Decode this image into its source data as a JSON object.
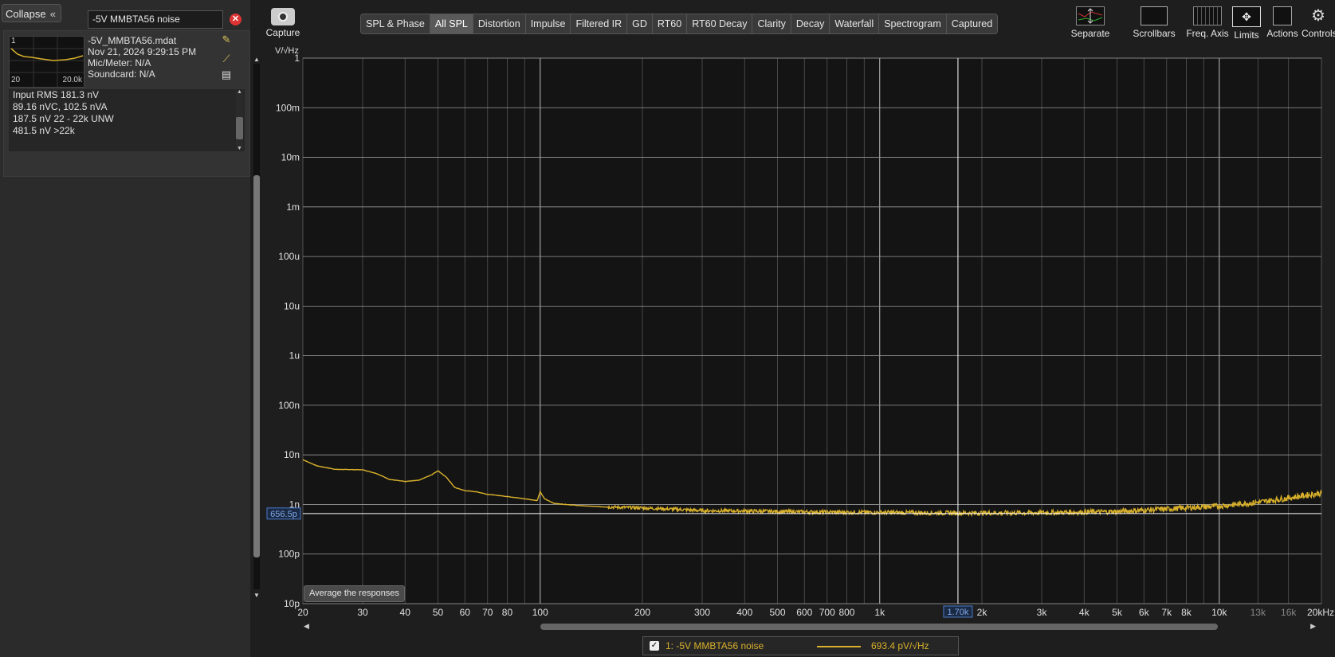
{
  "left_panel": {
    "collapse_label": "Collapse",
    "measurement_name": "-5V MMBTA56 noise",
    "thumbnail": {
      "index": "1",
      "x_start": "20",
      "x_end": "20.0k"
    },
    "file_name": "-5V_MMBTA56.mdat",
    "date": "Nov 21, 2024 9:29:15 PM",
    "mic_meter": "Mic/Meter: N/A",
    "soundcard": "Soundcard: N/A",
    "info_lines": [
      "Input RMS 181.3 nV",
      "89.16 nVC, 102.5 nVA",
      "187.5 nV 22 - 22k UNW",
      "481.5 nV >22k"
    ]
  },
  "toolbar": {
    "capture_label": "Capture",
    "tabs": [
      "SPL & Phase",
      "All SPL",
      "Distortion",
      "Impulse",
      "Filtered IR",
      "GD",
      "RT60",
      "RT60 Decay",
      "Clarity",
      "Decay",
      "Waterfall",
      "Spectrogram",
      "Captured"
    ],
    "active_tab": "All SPL",
    "tools": [
      "Separate",
      "Scrollbars",
      "Freq. Axis",
      "Limits",
      "Actions",
      "Controls"
    ]
  },
  "plot": {
    "y_unit": "V/√Hz",
    "y_cursor_value": "656.5p",
    "x_cursor_value": "1.70k",
    "average_button": "Average the responses"
  },
  "legend": {
    "checked": true,
    "label": "1: -5V MMBTA56 noise",
    "value": "693.4 pV/√Hz",
    "color": "#d8b02b"
  },
  "chart_data": {
    "type": "line",
    "xlabel": "",
    "ylabel": "V/√Hz",
    "x_scale": "log",
    "y_scale": "log",
    "xlim": [
      20,
      20000
    ],
    "ylim": [
      1e-11,
      1
    ],
    "y_ticks": [
      "1",
      "100m",
      "10m",
      "1m",
      "100u",
      "10u",
      "1u",
      "100n",
      "10n",
      "1n",
      "100p",
      "10p"
    ],
    "x_ticks": [
      "20",
      "30",
      "40",
      "50",
      "60",
      "70",
      "80",
      "100",
      "200",
      "300",
      "400",
      "500",
      "600",
      "700",
      "800",
      "1k",
      "2k",
      "3k",
      "4k",
      "5k",
      "6k",
      "7k",
      "8k",
      "10k",
      "13k",
      "16k",
      "20kHz"
    ],
    "grid": true,
    "cursor": {
      "x": 1700,
      "y": 6.565e-10
    },
    "series": [
      {
        "color": "#d8b02b",
        "x": [
          20,
          22,
          25,
          30,
          33,
          36,
          40,
          44,
          48,
          50,
          53,
          56,
          60,
          65,
          70,
          80,
          90,
          98,
          100,
          103,
          110,
          130,
          150,
          200,
          250,
          300,
          400,
          500,
          700,
          1000,
          1700,
          3000,
          5000,
          7000,
          10000,
          13000,
          16000,
          20000
        ],
        "y": [
          8e-09,
          6e-09,
          5.1e-09,
          5e-09,
          4.2e-09,
          3.2e-09,
          2.9e-09,
          3.1e-09,
          4e-09,
          4.8e-09,
          3.5e-09,
          2.2e-09,
          1.9e-09,
          1.8e-09,
          1.6e-09,
          1.45e-09,
          1.3e-09,
          1.2e-09,
          1.8e-09,
          1.3e-09,
          1.05e-09,
          9.5e-10,
          9e-10,
          8.5e-10,
          8e-10,
          7.5e-10,
          7.4e-10,
          7.2e-10,
          7e-10,
          6.9e-10,
          6.7e-10,
          6.8e-10,
          7.2e-10,
          8.1e-10,
          9.3e-10,
          1.1e-09,
          1.35e-09,
          1.7e-09
        ]
      }
    ]
  }
}
